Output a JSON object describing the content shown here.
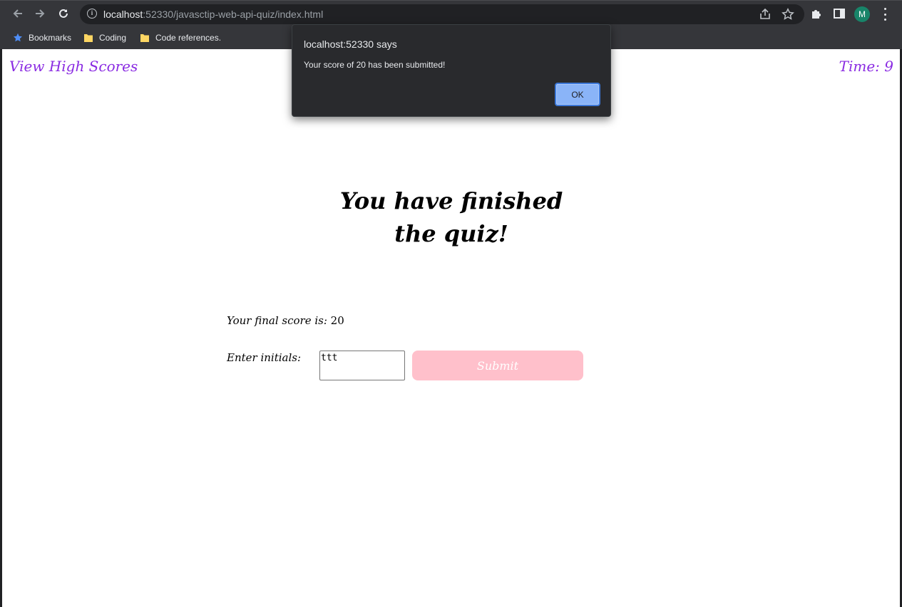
{
  "browser": {
    "url_host": "localhost",
    "url_rest": ":52330/javasctip-web-api-quiz/index.html",
    "profile_initial": "M",
    "bookmarks": [
      {
        "label": "Bookmarks",
        "icon": "star-icon"
      },
      {
        "label": "Coding",
        "icon": "folder-icon"
      },
      {
        "label": "Code references.",
        "icon": "folder-icon"
      }
    ]
  },
  "page": {
    "view_high_scores": "View High Scores",
    "timer": "Time: 9",
    "headline": "You have finished the quiz!",
    "final_score_label": "Your final score is: ",
    "final_score_value": "20",
    "initials_label": "Enter initials:",
    "initials_value": "ttt",
    "submit_label": "Submit",
    "accent_color": "#8a2be2",
    "submit_color": "#ffc0cb"
  },
  "dialog": {
    "title": "localhost:52330 says",
    "message": "Your score of 20 has been submitted!",
    "ok_label": "OK"
  }
}
